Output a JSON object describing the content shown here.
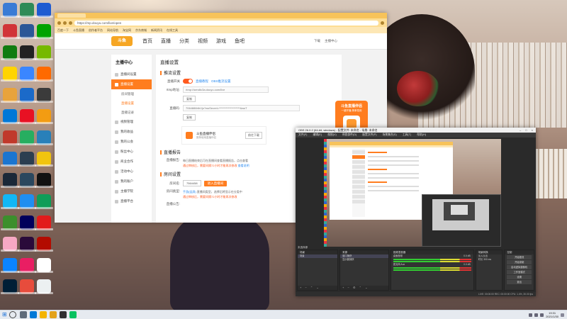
{
  "taskbar": {
    "start_icon": "windows-logo",
    "clock_time": "19:31",
    "clock_date": "2021/1/30"
  },
  "browser": {
    "url": "https://mp.douyu.com/live/open",
    "bookmarks": [
      "百度一下",
      "斗鱼直播",
      "创作者平台",
      "网站导航",
      "淘宝网",
      "京东商城",
      "新闻资讯",
      "在线工具"
    ]
  },
  "site": {
    "logo": "斗鱼",
    "nav": [
      "首页",
      "直播",
      "分类",
      "视频",
      "游戏",
      "鱼吧"
    ],
    "user": [
      "下载",
      "主播中心"
    ]
  },
  "sidebar": {
    "title": "主播中心",
    "items": [
      {
        "label": "直播间设置"
      },
      {
        "label": "直播设置",
        "active": true
      },
      {
        "label": "开播设置"
      },
      {
        "label": "直播记录"
      },
      {
        "label": "直播数据"
      },
      {
        "label": "视频管理"
      },
      {
        "label": "我的收益"
      },
      {
        "label": "我的公会"
      },
      {
        "label": "粉丝中心"
      },
      {
        "label": "商业合作"
      },
      {
        "label": "活动中心"
      },
      {
        "label": "我的账户"
      },
      {
        "label": "主播学院"
      },
      {
        "label": "直播平台"
      }
    ],
    "subitems": [
      "房间管理",
      "直播设置",
      "直播记录"
    ]
  },
  "main": {
    "title": "直播设置",
    "section1": "推流设置",
    "toggle_label": "直播开关",
    "toggle_link1": "直播教程",
    "toggle_link2": "OBS推流设置",
    "rtmp_label": "rtmp地址:",
    "rtmp_value": "rtmp://sendtc3a.douyu.com/live",
    "copy_btn": "复制",
    "key_label": "直播码:",
    "key_value": "7064888rIbVjo?wsSecret=*******************&wsT",
    "copy_btn2": "复制",
    "pc_title": "斗鱼直播伴侣",
    "pc_sub": "推荐使用直播伴侣",
    "pc_download": "前往下载",
    "section2": "直播报告",
    "report_label": "直播报告:",
    "report_text": "每日直播结束后可在直播间查看直播报告，点击查看",
    "report_warn": "通过审核后，需要间隔72小时才能再次修改",
    "report_link": "查看说明",
    "section3": "房间设置",
    "room_label": "房间名:",
    "room_value": "7564458",
    "room_btn": "进入直播间",
    "type_label": "房间类型:",
    "type_value": "手游(竖屏)",
    "type_note": "直播间类型，选择后将显示在分类中",
    "type_warn": "通过审核后，需要间隔72小时才能再次修改",
    "notice_label": "直播公告:"
  },
  "promo": {
    "title": "斗鱼直播伴侣",
    "sub": "一键开播 简单易用",
    "cta": "立即下载"
  },
  "obs": {
    "title": "OBS 26.0.2 (64-bit, windows) - 配置文件: 未命名 - 场景: 未命名",
    "menu": [
      "文件(F)",
      "编辑(E)",
      "视图(V)",
      "停靠部件(D)",
      "配置文件(P)",
      "场景集合(S)",
      "工具(T)",
      "帮助(H)"
    ],
    "status_title": "未选择源",
    "panels": {
      "scenes": {
        "title": "场景",
        "items": [
          "场景"
        ]
      },
      "sources": {
        "title": "来源",
        "items": [
          "窗口捕获",
          "显示器捕获"
        ]
      },
      "mixer": {
        "title": "音频混音器",
        "items": [
          "桌面音频",
          "麦克风/Aux"
        ],
        "levels": [
          "0.0 dB",
          "0.0 dB"
        ]
      },
      "transitions": {
        "title": "场景转换",
        "items": [
          "淡入淡出",
          "时长 300 ms"
        ]
      },
      "controls": {
        "title": "控制",
        "items": [
          "开始推流",
          "开始录制",
          "启动虚拟摄像机",
          "工作室模式",
          "设置",
          "退出"
        ]
      }
    },
    "status": "LIVE: 00:00:00   REC: 00:00:00   CPU: 1.4%, 30.00 fps"
  }
}
